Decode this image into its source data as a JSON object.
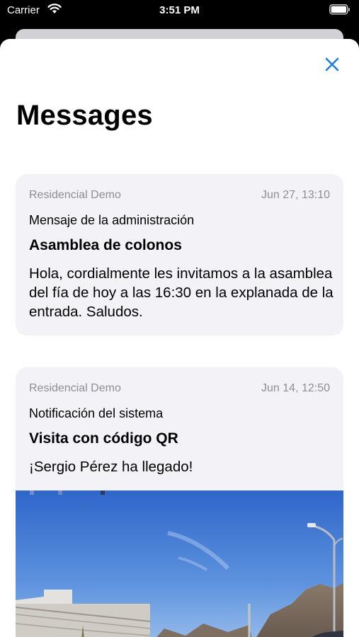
{
  "status_bar": {
    "carrier": "Carrier",
    "time": "3:51 PM",
    "icons": [
      "wifi-icon",
      "battery-icon"
    ]
  },
  "sheet": {
    "title": "Messages",
    "close_icon": "close-icon",
    "accent_color": "#1a7fd9"
  },
  "messages": [
    {
      "sender": "Residencial Demo",
      "date": "Jun 27, 13:10",
      "category": "Mensaje de la administración",
      "subject": "Asamblea de colonos",
      "body": "Hola, cordialmente les invitamos a la asamblea del fía de hoy a las 16:30 en la explanada de la entrada. Saludos."
    },
    {
      "sender": "Residencial Demo",
      "date": "Jun 14, 12:50",
      "category": "Notificación del sistema",
      "subject": "Visita con código QR",
      "body": "¡Sergio Pérez ha llegado!",
      "has_photo": true
    }
  ]
}
